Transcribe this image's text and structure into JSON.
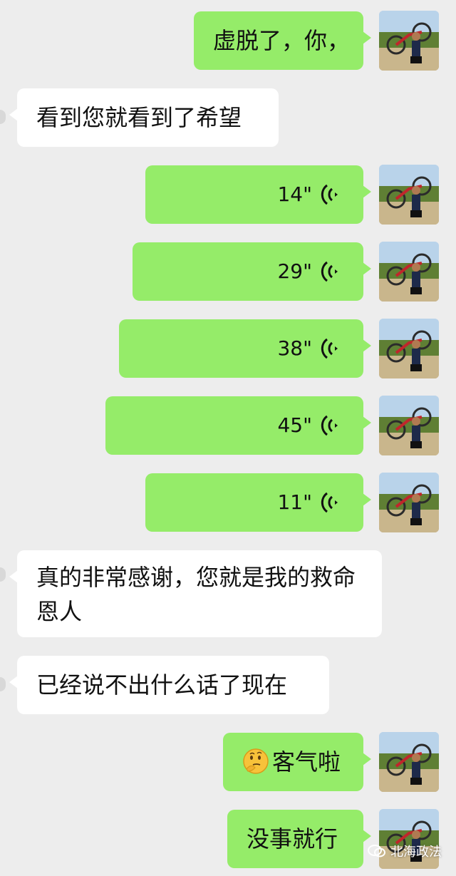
{
  "colors": {
    "background": "#ededed",
    "sent_bubble": "#95ec69",
    "received_bubble": "#ffffff"
  },
  "messages": [
    {
      "side": "sent",
      "type": "text",
      "text": "虚脱了，你，"
    },
    {
      "side": "received",
      "type": "text",
      "text": "看到您就看到了希望"
    },
    {
      "side": "sent",
      "type": "voice",
      "duration": "14\"",
      "icon": "voice-wave-icon"
    },
    {
      "side": "sent",
      "type": "voice",
      "duration": "29\"",
      "icon": "voice-wave-icon"
    },
    {
      "side": "sent",
      "type": "voice",
      "duration": "38\"",
      "icon": "voice-wave-icon"
    },
    {
      "side": "sent",
      "type": "voice",
      "duration": "45\"",
      "icon": "voice-wave-icon"
    },
    {
      "side": "sent",
      "type": "voice",
      "duration": "11\"",
      "icon": "voice-wave-icon"
    },
    {
      "side": "received",
      "type": "text",
      "text": "真的非常感谢，您就是我的救命恩人"
    },
    {
      "side": "received",
      "type": "text",
      "text": "已经说不出什么话了现在"
    },
    {
      "side": "sent",
      "type": "text",
      "text": "客气啦",
      "emoji": "thinking-face-emoji"
    },
    {
      "side": "sent",
      "type": "text",
      "text": "没事就行"
    }
  ],
  "watermark": {
    "text": "北海政法",
    "icon": "wechat-official-account-icon"
  }
}
